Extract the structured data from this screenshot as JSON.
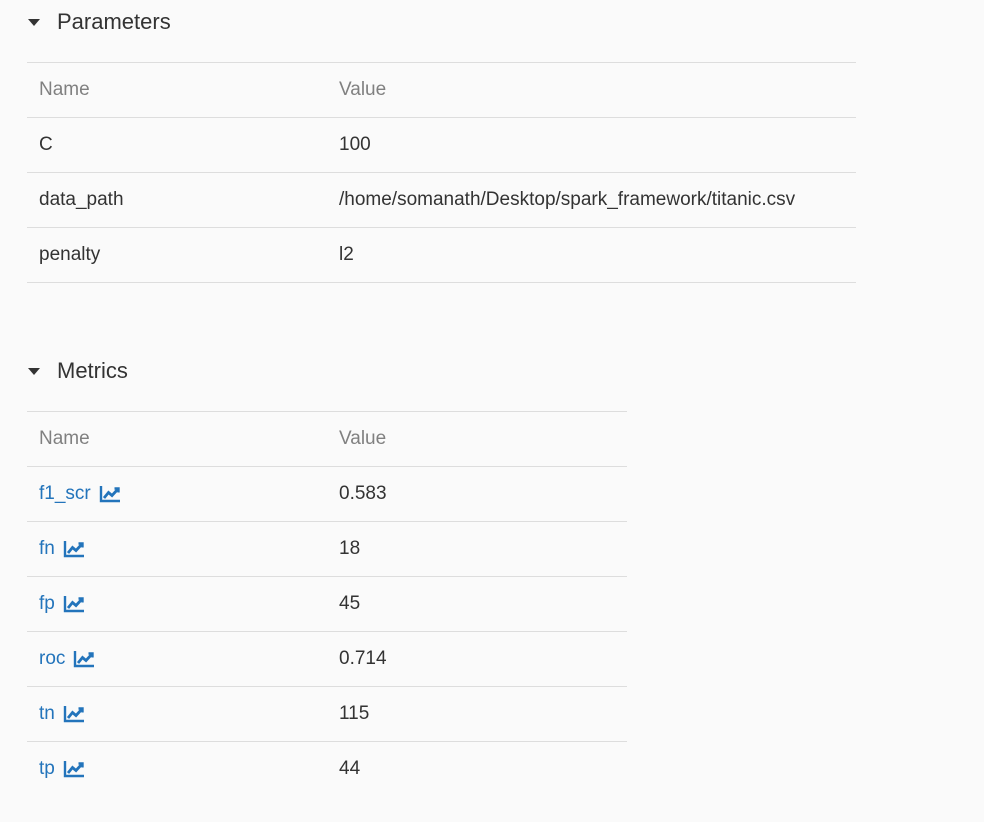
{
  "parameters": {
    "title": "Parameters",
    "columns": {
      "name": "Name",
      "value": "Value"
    },
    "rows": [
      {
        "name": "C",
        "value": "100"
      },
      {
        "name": "data_path",
        "value": "/home/somanath/Desktop/spark_framework/titanic.csv"
      },
      {
        "name": "penalty",
        "value": "l2"
      }
    ]
  },
  "metrics": {
    "title": "Metrics",
    "columns": {
      "name": "Name",
      "value": "Value"
    },
    "rows": [
      {
        "name": "f1_scr",
        "value": "0.583",
        "icon": "line-chart-icon"
      },
      {
        "name": "fn",
        "value": "18",
        "icon": "line-chart-icon"
      },
      {
        "name": "fp",
        "value": "45",
        "icon": "line-chart-icon"
      },
      {
        "name": "roc",
        "value": "0.714",
        "icon": "line-chart-icon"
      },
      {
        "name": "tn",
        "value": "115",
        "icon": "line-chart-icon"
      },
      {
        "name": "tp",
        "value": "44",
        "icon": "line-chart-icon"
      }
    ]
  },
  "colors": {
    "link": "#2374bb",
    "header_text": "#808080",
    "text": "#333333",
    "border": "#dddddd",
    "background": "#fafafa"
  }
}
